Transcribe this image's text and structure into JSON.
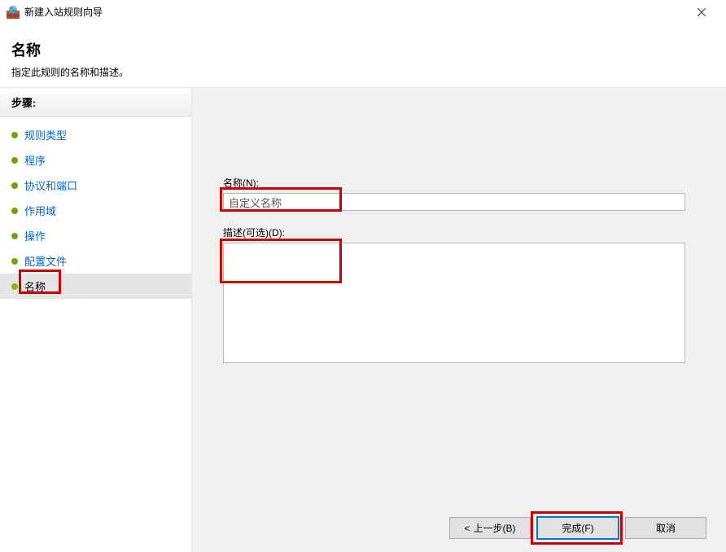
{
  "titlebar": {
    "title": "新建入站规则向导"
  },
  "header": {
    "title": "名称",
    "subtitle": "指定此规则的名称和描述。"
  },
  "sidebar": {
    "steps_header": "步骤:",
    "items": [
      {
        "label": "规则类型"
      },
      {
        "label": "程序"
      },
      {
        "label": "协议和端口"
      },
      {
        "label": "作用域"
      },
      {
        "label": "操作"
      },
      {
        "label": "配置文件"
      },
      {
        "label": "名称"
      }
    ]
  },
  "form": {
    "name_label": "名称(N):",
    "name_value": "自定义名称",
    "desc_label": "描述(可选)(D):",
    "desc_value": ""
  },
  "footer": {
    "back": "上一步(B)",
    "finish": "完成(F)",
    "cancel": "取消"
  }
}
